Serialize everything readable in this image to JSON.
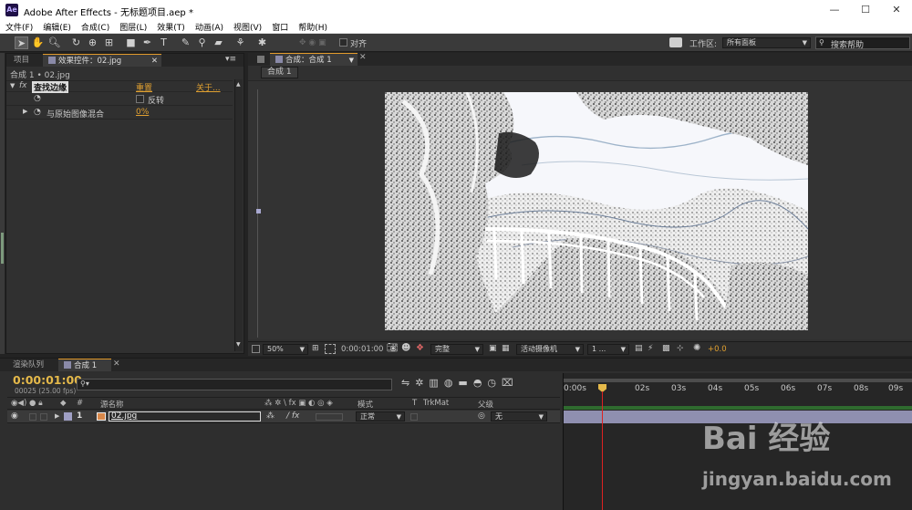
{
  "window": {
    "app_icon": "Ae",
    "title": "Adobe After Effects - 无标题项目.aep *",
    "minimize": "—",
    "maximize": "☐",
    "close": "✕"
  },
  "menu": [
    "文件(F)",
    "编辑(E)",
    "合成(C)",
    "图层(L)",
    "效果(T)",
    "动画(A)",
    "视图(V)",
    "窗口",
    "帮助(H)"
  ],
  "toolbar": {
    "align_label": "对齐",
    "workspace_label": "工作区:",
    "workspace_value": "所有面板",
    "search_placeholder": "搜索帮助"
  },
  "left_panel": {
    "tab_project": "项目",
    "tab_effects": "效果控件：02.jpg",
    "breadcrumb": "合成 1 • 02.jpg",
    "effect_fx": "fx",
    "effect_name": "查找边缘",
    "reset": "重置",
    "about": "关于...",
    "invert_label": "反转",
    "blend_label": "与原始图像混合",
    "blend_value": "0%"
  },
  "viewer": {
    "tab": "合成：合成 1",
    "subtab": "合成 1",
    "zoom": "50%",
    "timecode": "0:00:01:00",
    "resolution": "完整",
    "camera": "活动摄像机",
    "views": "1 ...",
    "exposure": "+0.0"
  },
  "timeline": {
    "tab_render": "渲染队列",
    "tab_comp": "合成 1",
    "timecode": "0:00:01:00",
    "fps": "00025 (25.00 fps)",
    "search_placeholder": "",
    "col_num": "#",
    "col_source": "源名称",
    "col_switches": "⁂ ✲ \\ fx ▣ ◐ ◎ ◈",
    "col_mode": "模式",
    "col_t": "T",
    "col_trkmat": "TrkMat",
    "col_parent": "父级",
    "layer": {
      "num": "1",
      "name": "02.jpg",
      "mode": "正常",
      "parent": "无"
    },
    "ruler": [
      "0:00s",
      "01s",
      "02s",
      "03s",
      "04s",
      "05s",
      "06s",
      "07s",
      "08s",
      "09s"
    ]
  },
  "watermark": {
    "brand": "Bai 经验",
    "url": "jingyan.baidu.com"
  }
}
